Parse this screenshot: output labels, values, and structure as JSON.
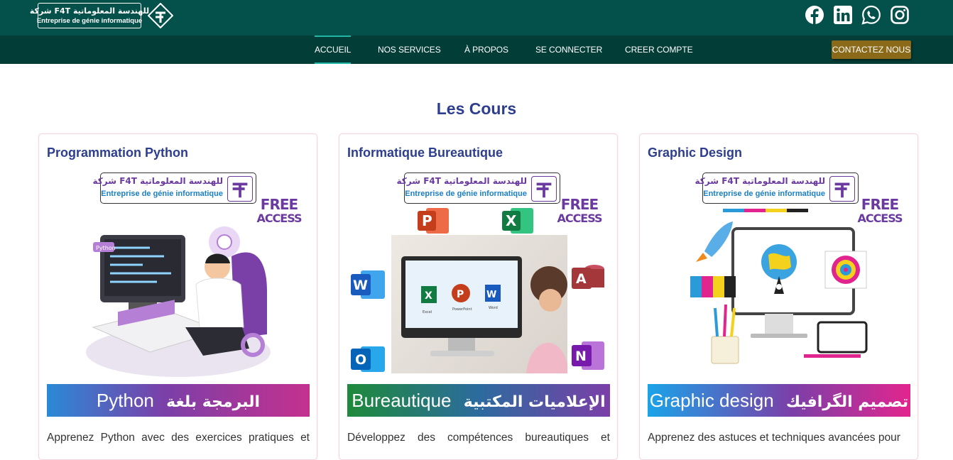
{
  "header": {
    "logo": {
      "arabic": "شركة F4T للهندسة المعلوماتية",
      "french": "Entreprise de génie informatique"
    },
    "social_icons": [
      "facebook-icon",
      "linkedin-icon",
      "whatsapp-icon",
      "instagram-icon"
    ]
  },
  "nav": {
    "items": [
      {
        "label": "ACCUEIL",
        "active": true
      },
      {
        "label": "NOS SERVICES",
        "active": false
      },
      {
        "label": "À PROPOS",
        "active": false
      },
      {
        "label": "SE CONNECTER",
        "active": false
      },
      {
        "label": "CREER COMPTE",
        "active": false
      }
    ],
    "cta_label": "CONTACTEZ NOUS"
  },
  "section": {
    "title": "Les Cours"
  },
  "courses": [
    {
      "title": "Programmation Python",
      "image": {
        "logo_ar": "شركة F4T للهندسة المعلوماتية",
        "logo_fr": "Entreprise de génie informatique",
        "badge_line1": "FREE",
        "badge_line2": "ACCESS",
        "tag": "Python",
        "banner_latin": "Python",
        "banner_arabic": "البرمجة بلغة"
      },
      "description": "Apprenez Python avec des exercices pratiques et"
    },
    {
      "title": "Informatique Bureautique",
      "image": {
        "logo_ar": "شركة F4T للهندسة المعلوماتية",
        "logo_fr": "Entreprise de génie informatique",
        "badge_line1": "FREE",
        "badge_line2": "ACCESS",
        "app_labels": [
          "Excel",
          "PowerPoint",
          "Word"
        ],
        "banner_latin": "Bureautique",
        "banner_arabic": "الإعلاميات المكتبية"
      },
      "description": "Développez des compétences bureautiques et"
    },
    {
      "title": "Graphic Design",
      "image": {
        "logo_ar": "شركة F4T للهندسة المعلوماتية",
        "logo_fr": "Entreprise de génie informatique",
        "badge_line1": "FREE",
        "badge_line2": "ACCESS",
        "banner_latin": "Graphic design",
        "banner_arabic": "تصميم الگرافيك"
      },
      "description": "Apprenez des astuces et techniques avancées pour"
    }
  ],
  "colors": {
    "topbar": "#03514a",
    "navbar": "#023d37",
    "nav_active_underline": "#1fb6a8",
    "cta": "#8a6a18",
    "title": "#2d3e8f",
    "brand_purple": "#6a3aa0"
  }
}
